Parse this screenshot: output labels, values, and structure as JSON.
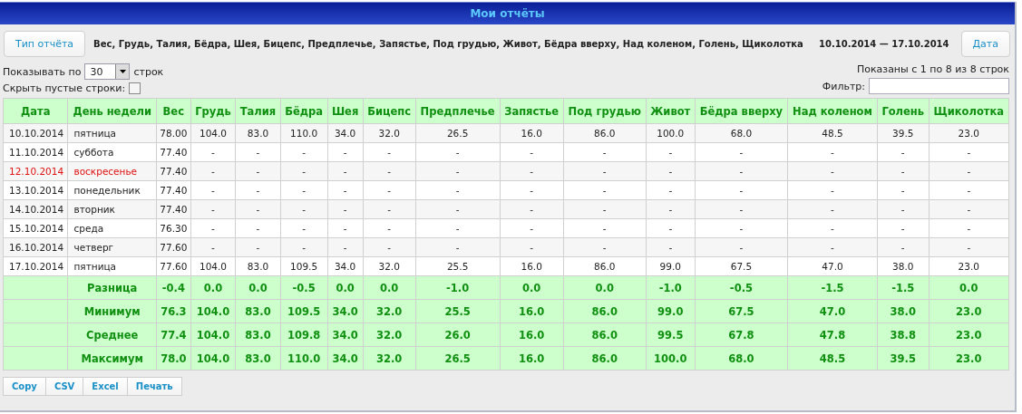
{
  "window": {
    "title": "Мои отчёты"
  },
  "toolbar": {
    "report_type_button": "Тип отчёта",
    "fields": "Вес, Грудь, Талия, Бёдра, Шея, Бицепс, Предплечье, Запястье, Под грудью, Живот, Бёдра вверху, Над коленом, Голень, Щиколотка",
    "date_range": "10.10.2014 — 17.10.2014",
    "date_button": "Дата"
  },
  "page_size": {
    "label_before": "Показывать по",
    "value": "30",
    "label_after": "строк"
  },
  "hide_empty": {
    "label": "Скрыть пустые строки:",
    "checked": false
  },
  "info": "Показаны с 1 по 8 из 8 строк",
  "filter": {
    "label": "Фильтр:"
  },
  "table": {
    "columns": [
      "Дата",
      "День недели",
      "Вес",
      "Грудь",
      "Талия",
      "Бёдра",
      "Шея",
      "Бицепс",
      "Предплечье",
      "Запястье",
      "Под грудью",
      "Живот",
      "Бёдра вверху",
      "Над коленом",
      "Голень",
      "Щиколотка"
    ],
    "rows": [
      {
        "weekend": false,
        "cells": [
          "10.10.2014",
          "пятница",
          "78.00",
          "104.0",
          "83.0",
          "110.0",
          "34.0",
          "32.0",
          "26.5",
          "16.0",
          "86.0",
          "100.0",
          "68.0",
          "48.5",
          "39.5",
          "23.0"
        ]
      },
      {
        "weekend": false,
        "cells": [
          "11.10.2014",
          "суббота",
          "77.40",
          "-",
          "-",
          "-",
          "-",
          "-",
          "-",
          "-",
          "-",
          "-",
          "-",
          "-",
          "-",
          "-"
        ]
      },
      {
        "weekend": true,
        "cells": [
          "12.10.2014",
          "воскресенье",
          "77.40",
          "-",
          "-",
          "-",
          "-",
          "-",
          "-",
          "-",
          "-",
          "-",
          "-",
          "-",
          "-",
          "-"
        ]
      },
      {
        "weekend": false,
        "cells": [
          "13.10.2014",
          "понедельник",
          "77.40",
          "-",
          "-",
          "-",
          "-",
          "-",
          "-",
          "-",
          "-",
          "-",
          "-",
          "-",
          "-",
          "-"
        ]
      },
      {
        "weekend": false,
        "cells": [
          "14.10.2014",
          "вторник",
          "77.40",
          "-",
          "-",
          "-",
          "-",
          "-",
          "-",
          "-",
          "-",
          "-",
          "-",
          "-",
          "-",
          "-"
        ]
      },
      {
        "weekend": false,
        "cells": [
          "15.10.2014",
          "среда",
          "76.30",
          "-",
          "-",
          "-",
          "-",
          "-",
          "-",
          "-",
          "-",
          "-",
          "-",
          "-",
          "-",
          "-"
        ]
      },
      {
        "weekend": false,
        "cells": [
          "16.10.2014",
          "четверг",
          "77.60",
          "-",
          "-",
          "-",
          "-",
          "-",
          "-",
          "-",
          "-",
          "-",
          "-",
          "-",
          "-",
          "-"
        ]
      },
      {
        "weekend": false,
        "cells": [
          "17.10.2014",
          "пятница",
          "77.60",
          "104.0",
          "83.0",
          "109.5",
          "34.0",
          "32.0",
          "25.5",
          "16.0",
          "86.0",
          "99.0",
          "67.5",
          "47.0",
          "38.0",
          "23.0"
        ]
      }
    ],
    "summary": [
      {
        "label": "Разница",
        "values": [
          "-0.4",
          "0.0",
          "0.0",
          "-0.5",
          "0.0",
          "0.0",
          "-1.0",
          "0.0",
          "0.0",
          "-1.0",
          "-0.5",
          "-1.5",
          "-1.5",
          "0.0"
        ]
      },
      {
        "label": "Минимум",
        "values": [
          "76.3",
          "104.0",
          "83.0",
          "109.5",
          "34.0",
          "32.0",
          "25.5",
          "16.0",
          "86.0",
          "99.0",
          "67.5",
          "47.0",
          "38.0",
          "23.0"
        ]
      },
      {
        "label": "Среднее",
        "values": [
          "77.4",
          "104.0",
          "83.0",
          "109.8",
          "34.0",
          "32.0",
          "26.0",
          "16.0",
          "86.0",
          "99.5",
          "67.8",
          "47.8",
          "38.8",
          "23.0"
        ]
      },
      {
        "label": "Максимум",
        "values": [
          "78.0",
          "104.0",
          "83.0",
          "110.0",
          "34.0",
          "32.0",
          "26.5",
          "16.0",
          "86.0",
          "100.0",
          "68.0",
          "48.5",
          "39.5",
          "23.0"
        ]
      }
    ]
  },
  "export_buttons": [
    "Copy",
    "CSV",
    "Excel",
    "Печать"
  ]
}
